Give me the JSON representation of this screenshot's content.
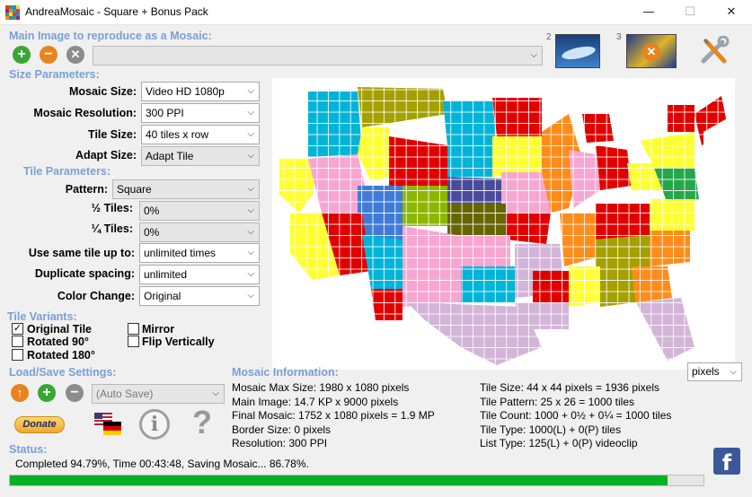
{
  "window": {
    "title": "AndreaMosaic - Square + Bonus Pack",
    "minimize_glyph": "—",
    "maximize_glyph": "☐",
    "close_glyph": "✕"
  },
  "main_image": {
    "heading": "Main Image to reproduce as a Mosaic:",
    "path_value": "",
    "badge_2": "2",
    "badge_3": "3"
  },
  "size_params": {
    "heading": "Size Parameters:",
    "mosaic_size_label": "Mosaic Size:",
    "mosaic_size_value": "Video HD 1080p",
    "resolution_label": "Mosaic Resolution:",
    "resolution_value": "300 PPI",
    "tile_size_label": "Tile Size:",
    "tile_size_value": "40 tiles x row",
    "adapt_size_label": "Adapt Size:",
    "adapt_size_value": "Adapt Tile"
  },
  "tile_params": {
    "heading": "Tile Parameters:",
    "pattern_label": "Pattern:",
    "pattern_value": "Square",
    "half_label": "½ Tiles:",
    "half_value": "0%",
    "quarter_label": "¼ Tiles:",
    "quarter_value": "0%",
    "same_tile_label": "Use same tile up to:",
    "same_tile_value": "unlimited times",
    "dup_label": "Duplicate spacing:",
    "dup_value": "unlimited",
    "color_label": "Color Change:",
    "color_value": "Original"
  },
  "tile_variants": {
    "heading": "Tile Variants:",
    "original": "Original Tile",
    "rotated90": "Rotated 90°",
    "rotated180": "Rotated 180°",
    "mirror": "Mirror",
    "flip": "Flip Vertically",
    "check": "✓"
  },
  "load_save": {
    "heading": "Load/Save Settings:",
    "combo_value": "(Auto Save)",
    "donate": "Donate"
  },
  "mosaic_info": {
    "heading": "Mosaic Information:",
    "units": "pixels",
    "left": [
      "Mosaic Max Size: 1980 x 1080 pixels",
      "Main Image: 14.7 KP x 9000 pixels",
      "Final Mosaic: 1752 x 1080 pixels = 1.9 MP",
      "Border Size: 0 pixels",
      "Resolution: 300 PPI"
    ],
    "right": [
      "Tile Size: 44 x 44 pixels = 1936 pixels",
      "Tile Pattern: 25 x 26 = 1000 tiles",
      "Tile Count: 1000 + 0½ + 0¼ = 1000 tiles",
      "Tile Type: 1000(L) + 0(P) tiles",
      "List Type: 125(L) + 0(P) videoclip"
    ]
  },
  "status": {
    "heading": "Status:",
    "text": "Completed 94.79%, Time 00:43:48, Saving Mosaic... 86.78%.",
    "progress": 0.948,
    "progress_color": "#06b025"
  },
  "colors": {
    "section": "#7a9fd6",
    "add": "#3aa635",
    "remove": "#e8831e",
    "clear": "#8c8c8c"
  }
}
